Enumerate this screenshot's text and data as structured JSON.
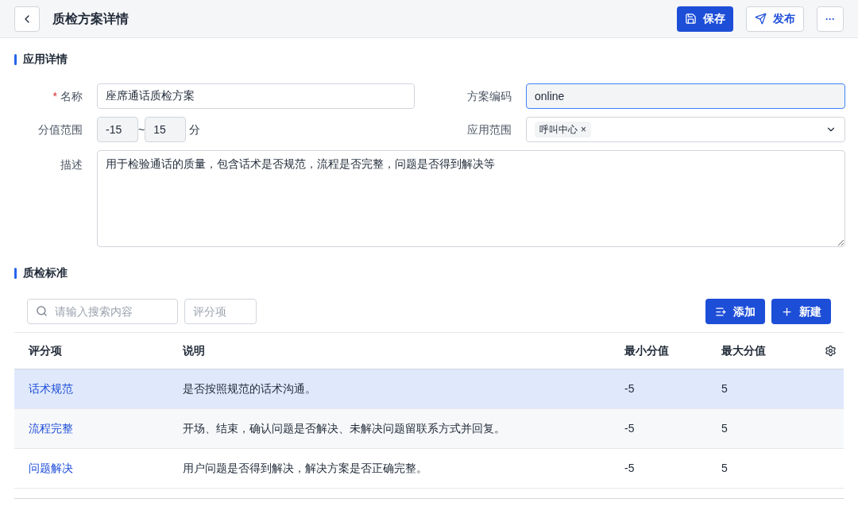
{
  "header": {
    "title": "质检方案详情",
    "actions": [
      {
        "kind": "save",
        "label": "保存",
        "primary": true
      },
      {
        "kind": "publish",
        "label": "发布",
        "primary": false
      }
    ],
    "more": "···"
  },
  "details": {
    "title": "应用详情",
    "name": {
      "label": "名称",
      "required": true,
      "required_mark": "*",
      "value": "座席通话质检方案"
    },
    "code": {
      "label": "方案编码",
      "value": "online",
      "focused": true
    },
    "score_range": {
      "label": "分值范围",
      "min": "-15",
      "separator": "~",
      "max": "15",
      "unit": "分"
    },
    "scope": {
      "label": "应用范围",
      "tags": [
        {
          "label": "呼叫中心",
          "remove": "×"
        }
      ]
    },
    "description": {
      "label": "描述",
      "value": "用于检验通话的质量，包含话术是否规范，流程是否完整，问题是否得到解决等"
    }
  },
  "standards": {
    "title": "质检标准",
    "search": {
      "placeholder": "请输入搜索内容"
    },
    "filter": {
      "placeholder": "评分项"
    },
    "buttons": [
      {
        "kind": "add",
        "label": "添加"
      },
      {
        "kind": "new",
        "label": "新建"
      }
    ],
    "columns": [
      "评分项",
      "说明",
      "最小分值",
      "最大分值"
    ],
    "rows": [
      {
        "item": "话术规范",
        "description": "是否按照规范的话术沟通。",
        "min": "-5",
        "max": "5",
        "selected": true
      },
      {
        "item": "流程完整",
        "description": "开场、结束，确认问题是否解决、未解决问题留联系方式并回复。",
        "min": "-5",
        "max": "5",
        "selected": false
      },
      {
        "item": "问题解决",
        "description": "用户问题是否得到解决，解决方案是否正确完整。",
        "min": "-5",
        "max": "5",
        "selected": false
      }
    ]
  }
}
